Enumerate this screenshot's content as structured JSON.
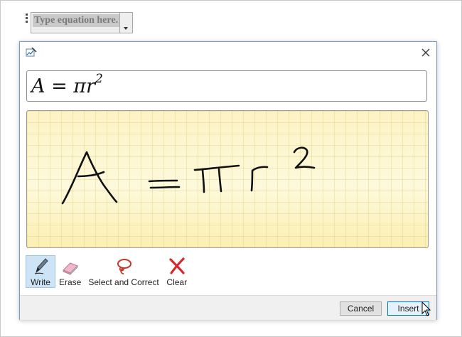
{
  "document": {
    "equation_placeholder": "Type equation here."
  },
  "dialog": {
    "title": "",
    "preview_equation": {
      "base": "A = πr",
      "exponent": "2"
    },
    "tools": [
      {
        "label": "Write",
        "icon": "pen-icon",
        "active": true
      },
      {
        "label": "Erase",
        "icon": "eraser-icon",
        "active": false
      },
      {
        "label": "Select and Correct",
        "icon": "lasso-icon",
        "active": false
      },
      {
        "label": "Clear",
        "icon": "clear-x-icon",
        "active": false
      }
    ],
    "buttons": {
      "cancel": "Cancel",
      "insert": "Insert"
    }
  },
  "colors": {
    "ink": "#111111",
    "pad_background": "#fdf6c2",
    "selected_tool": "#cde4f7",
    "clear_icon": "#d9262c",
    "lasso_icon": "#c0392b"
  }
}
